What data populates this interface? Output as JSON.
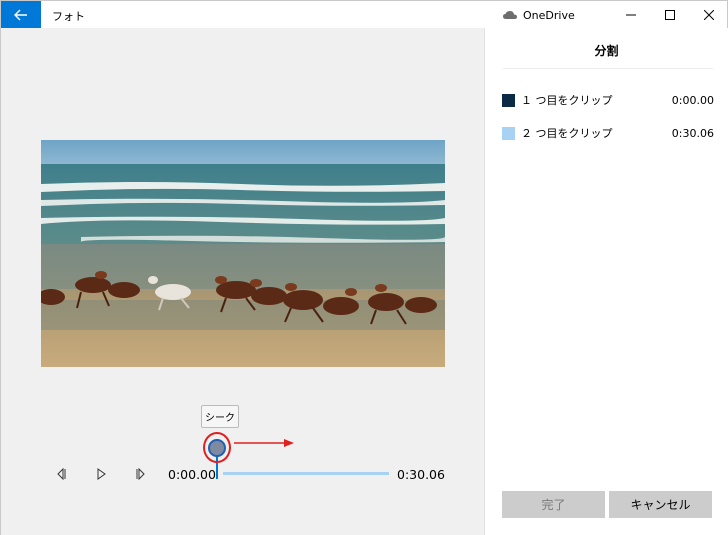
{
  "window": {
    "app_title": "フォト",
    "onedrive_label": "OneDrive"
  },
  "player": {
    "seek_tooltip": "シーク",
    "current_time": "0:00.00",
    "total_time": "0:30.06",
    "playhead_fraction": 0.0
  },
  "panel": {
    "title": "分割",
    "clips": [
      {
        "label": "１ つ目をクリップ",
        "time": "0:00.00",
        "color": "#0b2a45"
      },
      {
        "label": "２ つ目をクリップ",
        "time": "0:30.06",
        "color": "#a8d2f3"
      }
    ],
    "done_label": "完了",
    "cancel_label": "キャンセル"
  },
  "colors": {
    "accent": "#0078d7",
    "annotation": "#e02020"
  }
}
